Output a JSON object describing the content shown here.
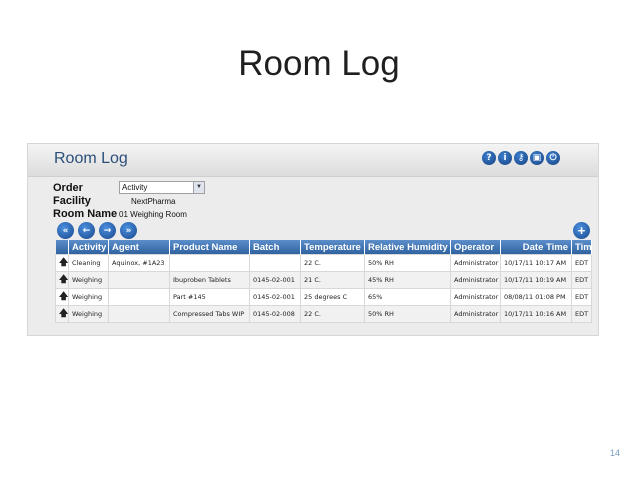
{
  "slide": {
    "title": "Room Log",
    "page_number": "14"
  },
  "panel": {
    "title": "Room Log",
    "header_icons": [
      {
        "name": "help-icon",
        "glyph": "?"
      },
      {
        "name": "info-icon",
        "glyph": "i"
      },
      {
        "name": "key-icon",
        "glyph": "⚷"
      },
      {
        "name": "lock-icon",
        "glyph": "▣"
      },
      {
        "name": "logout-icon",
        "glyph": "⏻"
      }
    ]
  },
  "form": {
    "order_label": "Order",
    "order_value": "Activity",
    "facility_label": "Facility",
    "facility_value": "NextPharma",
    "room_label": "Room Name",
    "room_value": "01  Weighing Room"
  },
  "nav": {
    "buttons": [
      {
        "name": "first-page-icon",
        "glyph": "«"
      },
      {
        "name": "previous-page-icon",
        "glyph": "←"
      },
      {
        "name": "next-page-icon",
        "glyph": "→"
      },
      {
        "name": "last-page-icon",
        "glyph": "»"
      }
    ],
    "add": {
      "name": "add-icon",
      "glyph": "+"
    }
  },
  "table": {
    "columns": [
      "Activity",
      "Agent",
      "Product Name",
      "Batch",
      "Temperature",
      "Relative Humidity",
      "Operator",
      "Date Time",
      "Tim"
    ],
    "rows": [
      {
        "activity": "Cleaning",
        "agent": "Aquinox, #1A23",
        "product": "",
        "batch": "",
        "temperature": "22 C.",
        "humidity": "50% RH",
        "operator": "Administrator",
        "datetime": "10/17/11 10:17 AM",
        "tz": "EDT"
      },
      {
        "activity": "Weighing",
        "agent": "",
        "product": "Ibuproben Tablets",
        "batch": "0145-02-001",
        "temperature": "21 C.",
        "humidity": "45% RH",
        "operator": "Administrator",
        "datetime": "10/17/11 10:19 AM",
        "tz": "EDT"
      },
      {
        "activity": "Weighing",
        "agent": "",
        "product": "Part #145",
        "batch": "0145-02-001",
        "temperature": "25 degrees C",
        "humidity": "65%",
        "operator": "Administrator",
        "datetime": "08/08/11 01:08 PM",
        "tz": "EDT"
      },
      {
        "activity": "Weighing",
        "agent": "",
        "product": "Compressed Tabs WIP",
        "batch": "0145-02-008",
        "temperature": "22 C.",
        "humidity": "50% RH",
        "operator": "Administrator",
        "datetime": "10/17/11 10:16 AM",
        "tz": "EDT"
      }
    ]
  }
}
